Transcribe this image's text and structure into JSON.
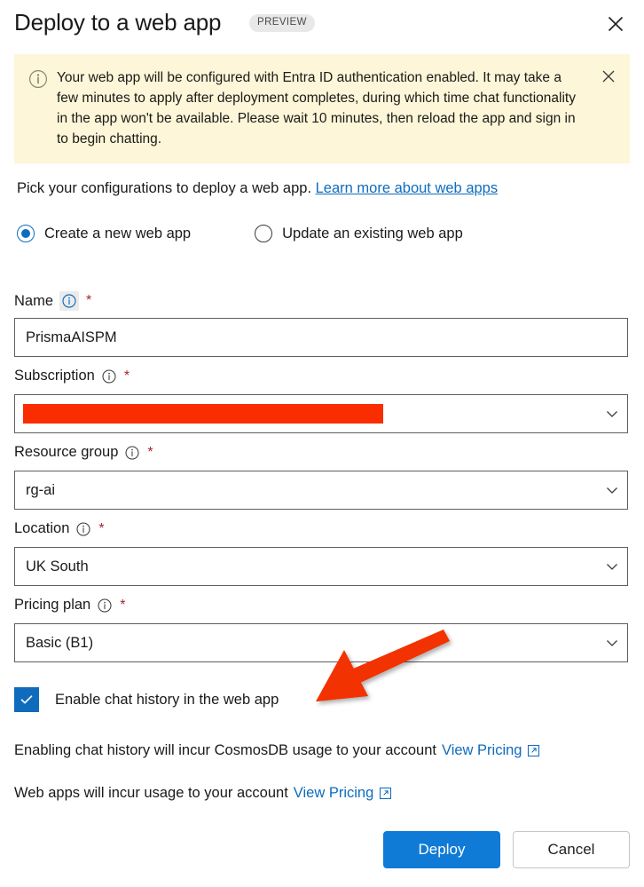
{
  "dialog": {
    "title": "Deploy to a web app",
    "preview_badge": "PREVIEW",
    "close_icon": "close-icon"
  },
  "banner": {
    "icon": "info-circle-icon",
    "text": "Your web app will be configured with Entra ID authentication enabled. It may take a few minutes to apply after deployment completes, during which time chat functionality in the app won't be available. Please wait 10 minutes, then reload the app and sign in to begin chatting.",
    "close_icon": "close-icon",
    "background_color": "#FDF6D8"
  },
  "intro": {
    "text": "Pick your configurations to deploy a web app.",
    "link_label": "Learn more about web apps"
  },
  "deploy_mode": {
    "options": [
      {
        "label": "Create a new web app",
        "selected": true
      },
      {
        "label": "Update an existing web app",
        "selected": false
      }
    ]
  },
  "fields": [
    {
      "label": "Name",
      "required_marker": "*",
      "info_icon": "info-circle-icon",
      "info_highlighted": true,
      "type": "text",
      "value": "PrismaAISPM",
      "placeholder": ""
    },
    {
      "label": "Subscription",
      "required_marker": "*",
      "info_icon": "info-circle-icon",
      "info_highlighted": false,
      "type": "select",
      "value": "",
      "redacted": true,
      "chevron_icon": "chevron-down-icon"
    },
    {
      "label": "Resource group",
      "required_marker": "*",
      "info_icon": "info-circle-icon",
      "info_highlighted": false,
      "type": "select",
      "value": "rg-ai",
      "redacted": false,
      "chevron_icon": "chevron-down-icon"
    },
    {
      "label": "Location",
      "required_marker": "*",
      "info_icon": "info-circle-icon",
      "info_highlighted": false,
      "type": "select",
      "value": "UK South",
      "redacted": false,
      "chevron_icon": "chevron-down-icon"
    },
    {
      "label": "Pricing plan",
      "required_marker": "*",
      "info_icon": "info-circle-icon",
      "info_highlighted": false,
      "type": "select",
      "value": "Basic (B1)",
      "redacted": false,
      "chevron_icon": "chevron-down-icon"
    }
  ],
  "chat_history": {
    "label": "Enable chat history in the web app",
    "checked": true,
    "check_icon": "checkmark-icon"
  },
  "notes": [
    {
      "text": "Enabling chat history will incur CosmosDB usage to your account",
      "link_label": "View Pricing",
      "link_icon": "external-link-icon"
    },
    {
      "text": "Web apps will incur usage to your account",
      "link_label": "View Pricing",
      "link_icon": "external-link-icon"
    }
  ],
  "footer": {
    "primary_label": "Deploy",
    "secondary_label": "Cancel"
  },
  "annotation": {
    "type": "arrow",
    "color": "#F23005",
    "points_to": "Enable chat history in the web app"
  },
  "colors": {
    "accent": "#0F6CBD",
    "primary_button": "#0F7BD6",
    "required": "#A4262C",
    "banner_bg": "#FDF6D8",
    "redaction": "#FA2D00"
  }
}
